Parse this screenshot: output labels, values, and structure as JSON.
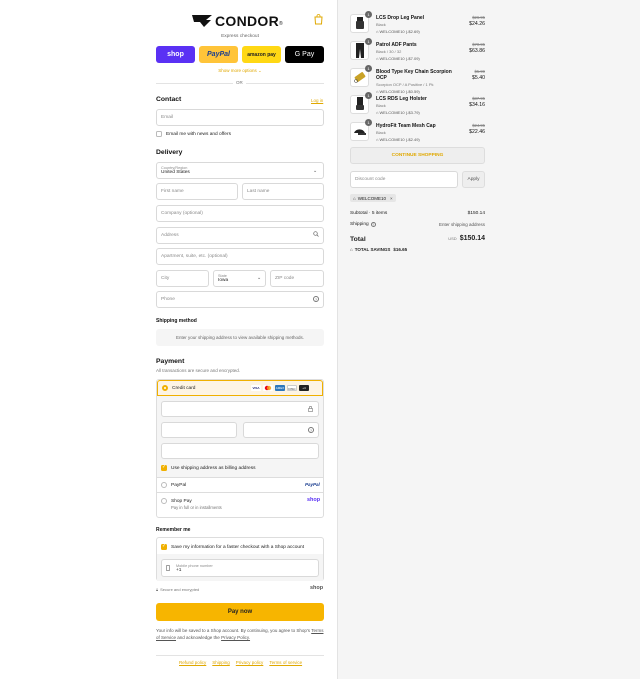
{
  "brand": {
    "name": "CONDOR",
    "reg": "®"
  },
  "express": {
    "label": "Express checkout",
    "shop": "shop",
    "paypal": "PayPal",
    "amazon": "amazon pay",
    "gpay": "G Pay",
    "more": "Show more options",
    "or": "OR"
  },
  "contact": {
    "title": "Contact",
    "login": "Log in",
    "email_placeholder": "Email",
    "newsletter": "Email me with news and offers"
  },
  "delivery": {
    "title": "Delivery",
    "country_label": "Country/Region",
    "country_value": "United States",
    "first_name": "First name",
    "last_name": "Last name",
    "company": "Company (optional)",
    "address": "Address",
    "apartment": "Apartment, suite, etc. (optional)",
    "city": "City",
    "state_label": "State",
    "state_value": "Iowa",
    "zip": "ZIP code",
    "phone": "Phone"
  },
  "shipping_method": {
    "title": "Shipping method",
    "message": "Enter your shipping address to view available shipping methods."
  },
  "payment": {
    "title": "Payment",
    "subtitle": "All transactions are secure and encrypted.",
    "credit_card": "Credit card",
    "card_logos": [
      "VISA",
      "MC",
      "AMEX",
      "DISC",
      "+4"
    ],
    "billing_same": "Use shipping address as billing address",
    "paypal": "PayPal",
    "paypal_logo": "PayPal",
    "shop_pay": "Shop Pay",
    "shop_pay_sub": "Pay in full or in installments",
    "shop_logo": "shop"
  },
  "remember": {
    "title": "Remember me",
    "save_info": "Save my information for a faster checkout with a Shop account",
    "phone_label": "Mobile phone number",
    "phone_value": "+1",
    "secure": "Secure and encrypted",
    "shop_logo": "shop"
  },
  "pay_button": "Pay now",
  "legal": {
    "text1": "Your info will be saved to a Shop account. By continuing, you agree to Shop's",
    "tos": "Terms of Service",
    "text2": "and acknowledge the",
    "privacy": "Privacy Policy."
  },
  "footer": [
    "Refund policy",
    "Shipping",
    "Privacy policy",
    "Terms of service"
  ],
  "cart": {
    "items": [
      {
        "qty": "1",
        "name": "LCS Drop Leg Panel",
        "variant": "Black",
        "discount": "WELCOME10 (-$2.69)",
        "old": "$26.95",
        "price": "$24.26"
      },
      {
        "qty": "1",
        "name": "Patrol ADF Pants",
        "variant": "Black / 30 / 32",
        "discount": "WELCOME10 (-$7.09)",
        "old": "$70.95",
        "price": "$63.86"
      },
      {
        "qty": "1",
        "name": "Blood Type Key Chain Scorpion OCP",
        "variant": "Scorpion OCP / A Positive / 1 Pk",
        "discount": "WELCOME10 (-$0.59)",
        "old": "$5.99",
        "price": "$5.40"
      },
      {
        "qty": "1",
        "name": "LCS RDS Leg Holster",
        "variant": "Black",
        "discount": "WELCOME10 (-$3.79)",
        "old": "$37.95",
        "price": "$34.16"
      },
      {
        "qty": "1",
        "name": "HydroFit Team Mesh Cap",
        "variant": "Black",
        "discount": "WELCOME10 (-$2.49)",
        "old": "$24.95",
        "price": "$22.46"
      }
    ],
    "continue": "CONTINUE SHOPPING",
    "discount_placeholder": "Discount code",
    "apply": "Apply",
    "applied_code": "WELCOME10",
    "subtotal_label": "Subtotal · 5 items",
    "subtotal": "$150.14",
    "shipping_label": "Shipping",
    "shipping_value": "Enter shipping address",
    "total_label": "Total",
    "currency": "USD",
    "total": "$150.14",
    "savings_label": "TOTAL SAVINGS",
    "savings": "$16.65"
  },
  "colors": {
    "accent": "#f7b500",
    "shop": "#5a31f4",
    "paypal": "#ffc439"
  }
}
